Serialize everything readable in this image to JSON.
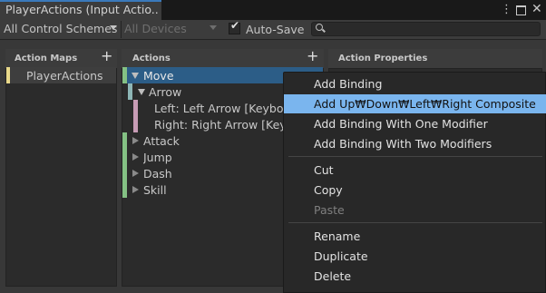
{
  "window": {
    "tab_title": "PlayerActions (Input Actio...",
    "menu_icon": "kebab-icon",
    "maximize_icon": "maximize-icon",
    "close_glyph": "✕"
  },
  "toolbar": {
    "control_schemes": "All Control Schemes",
    "devices": "All Devices",
    "auto_save_label": "Auto-Save",
    "auto_save_checked": true,
    "search_placeholder": ""
  },
  "panels": {
    "action_maps_title": "Action Maps",
    "actions_title": "Actions",
    "action_properties_title": "Action Properties",
    "add_glyph": "+"
  },
  "action_maps": [
    {
      "label": "PlayerActions",
      "color": "#e9d98a"
    }
  ],
  "actions": [
    {
      "label": "Move",
      "selected": true,
      "color": "#84c184"
    },
    {
      "label": "Arrow",
      "color": "#8db6b6"
    },
    {
      "label": "Left: Left Arrow [Keyboard]",
      "color": "#c79cb5"
    },
    {
      "label": "Right: Right Arrow [Keyboard]",
      "color": "#c79cb5"
    },
    {
      "label": "Attack",
      "color": "#84c184"
    },
    {
      "label": "Jump",
      "color": "#84c184"
    },
    {
      "label": "Dash",
      "color": "#84c184"
    },
    {
      "label": "Skill",
      "color": "#84c184"
    }
  ],
  "context_menu": {
    "items": [
      {
        "label": "Add Binding"
      },
      {
        "label": "Add Up₩Down₩Left₩Right Composite",
        "highlighted": true
      },
      {
        "label": "Add Binding With One Modifier"
      },
      {
        "label": "Add Binding With Two Modifiers"
      },
      {
        "label": "Cut"
      },
      {
        "label": "Copy"
      },
      {
        "label": "Paste",
        "disabled": true
      },
      {
        "label": "Rename"
      },
      {
        "label": "Duplicate"
      },
      {
        "label": "Delete"
      }
    ]
  },
  "colors": {
    "highlight": "#7ab5ee",
    "selected_row": "#2c5d87",
    "tab_accent": "#3a79bb"
  }
}
